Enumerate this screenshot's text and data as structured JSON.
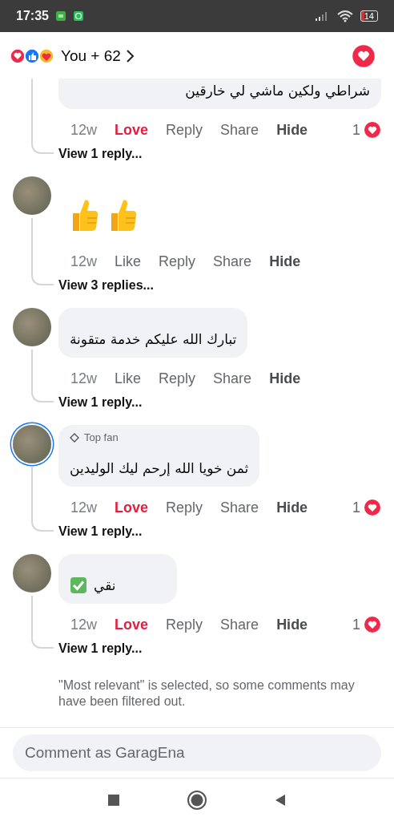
{
  "status_bar": {
    "time": "17:35",
    "battery": "14"
  },
  "reactions": {
    "summary": "You + 62",
    "reacted": true
  },
  "partial_comment": {
    "text": "شراطي ولكين ماشي لي خارقين",
    "time": "12w",
    "reaction": {
      "label": "Love",
      "selected": true
    },
    "actions": [
      "Reply",
      "Share",
      "Hide"
    ],
    "reaction_count": "1",
    "view_replies": "View 1 reply..."
  },
  "comments": [
    {
      "kind": "thumbs",
      "time": "12w",
      "reaction": {
        "label": "Like",
        "selected": false
      },
      "actions": [
        "Reply",
        "Share",
        "Hide"
      ],
      "view_replies": "View 3 replies..."
    },
    {
      "kind": "text",
      "text": "تبارك الله عليكم خدمة متقونة",
      "time": "12w",
      "reaction": {
        "label": "Like",
        "selected": false
      },
      "actions": [
        "Reply",
        "Share",
        "Hide"
      ],
      "view_replies": "View 1 reply..."
    },
    {
      "kind": "text",
      "top_fan": "Top fan",
      "text": "ثمن خويا الله إرحم ليك الوليدين",
      "time": "12w",
      "reaction": {
        "label": "Love",
        "selected": true
      },
      "actions": [
        "Reply",
        "Share",
        "Hide"
      ],
      "reaction_count": "1",
      "view_replies": "View 1 reply..."
    },
    {
      "kind": "check_text",
      "text": "نقي",
      "time": "12w",
      "reaction": {
        "label": "Love",
        "selected": true
      },
      "actions": [
        "Reply",
        "Share",
        "Hide"
      ],
      "reaction_count": "1",
      "view_replies": "View 1 reply..."
    }
  ],
  "footer_note": "\"Most relevant\" is selected, so some comments may have been filtered out.",
  "composer": {
    "placeholder": "Comment as GaragEna"
  }
}
